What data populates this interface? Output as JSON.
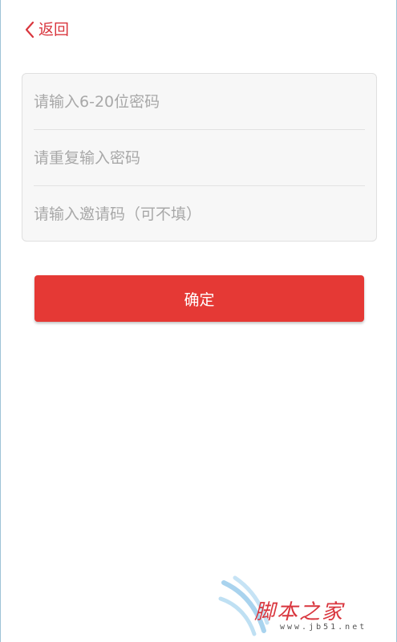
{
  "header": {
    "back_label": "返回"
  },
  "form": {
    "password_placeholder": "请输入6-20位密码",
    "repeat_password_placeholder": "请重复输入密码",
    "invite_code_placeholder": "请输入邀请码（可不填）"
  },
  "actions": {
    "confirm_label": "确定"
  },
  "watermark": {
    "title": "脚本之家",
    "url": "www.jb51.net"
  },
  "colors": {
    "accent": "#d9363e",
    "button_bg": "#e53935",
    "card_bg": "#f7f7f7",
    "placeholder": "#a8a8a8"
  },
  "icons": {
    "back": "chevron-left-icon"
  }
}
